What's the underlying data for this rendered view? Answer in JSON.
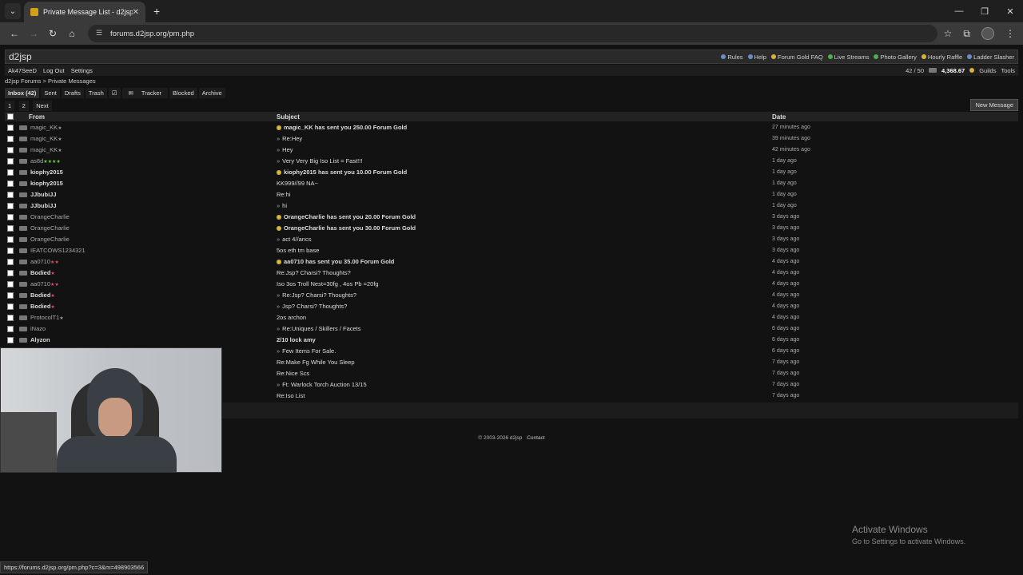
{
  "browser": {
    "tab_title": "Private Message List - d2jsp",
    "url": "forums.d2jsp.org/pm.php",
    "status_url": "https://forums.d2jsp.org/pm.php?c=3&m=498903566"
  },
  "site": {
    "logo": "d2jsp",
    "top_links": [
      "Rules",
      "Help",
      "Forum Gold FAQ",
      "Live Streams",
      "Photo Gallery",
      "Hourly Raffle",
      "Ladder Slasher"
    ],
    "user": "Ak47SeeD",
    "logout": "Log Out",
    "settings": "Settings",
    "pm_count": "42 / 50",
    "gold": "4,368.67",
    "guilds": "Guilds",
    "tools": "Tools",
    "crumb1": "d2jsp Forums",
    "crumb_sep": ">",
    "crumb2": "Private Messages"
  },
  "folders": {
    "inbox": "Inbox (42)",
    "sent": "Sent",
    "drafts": "Drafts",
    "trash": "Trash",
    "tracker": "Tracker",
    "blocked": "Blocked",
    "archive": "Archive"
  },
  "pager": {
    "p1": "1",
    "p2": "2",
    "next": "Next",
    "new_message": "New Message"
  },
  "table": {
    "col_from": "From",
    "col_subject": "Subject",
    "col_date": "Date"
  },
  "messages": [
    {
      "from": "magic_KK",
      "subject": "magic_KK has sent you 250.00 Forum Gold",
      "date": "27 minutes ago"
    },
    {
      "from": "magic_KK",
      "subject": "Re:Hey",
      "date": "39 minutes ago"
    },
    {
      "from": "magic_KK",
      "subject": "Hey",
      "date": "42 minutes ago"
    },
    {
      "from": "as8d",
      "subject": "Very Very Big Iso List = Fast!!!",
      "date": "1 day ago"
    },
    {
      "from": "kiophy2015",
      "subject": "kiophy2015 has sent you 10.00 Forum Gold",
      "date": "1 day ago"
    },
    {
      "from": "kiophy2015",
      "subject": "KK999//99 NA~",
      "date": "1 day ago"
    },
    {
      "from": "JJbubiJJ",
      "subject": "Re:hi",
      "date": "1 day ago"
    },
    {
      "from": "JJbubiJJ",
      "subject": "hi",
      "date": "1 day ago"
    },
    {
      "from": "OrangeCharlie",
      "subject": "OrangeCharlie has sent you 20.00 Forum Gold",
      "date": "3 days ago"
    },
    {
      "from": "OrangeCharlie",
      "subject": "OrangeCharlie has sent you 30.00 Forum Gold",
      "date": "3 days ago"
    },
    {
      "from": "OrangeCharlie",
      "subject": "act 4//ancs",
      "date": "3 days ago"
    },
    {
      "from": "IEATCOWS1234321",
      "subject": "5os eth tm base",
      "date": "3 days ago"
    },
    {
      "from": "aa0710",
      "subject": "aa0710 has sent you 35.00 Forum Gold",
      "date": "4 days ago"
    },
    {
      "from": "Bodied",
      "subject": "Re:Jsp? Charsi? Thoughts?",
      "date": "4 days ago"
    },
    {
      "from": "aa0710",
      "subject": "Iso 3os Troll Nest=30fg , 4os Pb =20fg",
      "date": "4 days ago"
    },
    {
      "from": "Bodied",
      "subject": "Re:Jsp? Charsi? Thoughts?",
      "date": "4 days ago"
    },
    {
      "from": "Bodied",
      "subject": "Jsp? Charsi? Thoughts?",
      "date": "4 days ago"
    },
    {
      "from": "ProtocolT1",
      "subject": "2os archon",
      "date": "4 days ago"
    },
    {
      "from": "iNazo",
      "subject": "Re:Uniques / Skillers / Facets",
      "date": "6 days ago"
    },
    {
      "from": "Alyzon",
      "subject": "2/10 lock amy",
      "date": "6 days ago"
    },
    {
      "from": "",
      "subject": "Few Items For Sale.",
      "date": "6 days ago"
    },
    {
      "from": "",
      "subject": "Re:Make Fg While You Sleep",
      "date": "7 days ago"
    },
    {
      "from": "",
      "subject": "Re:Nice Scs",
      "date": "7 days ago"
    },
    {
      "from": "",
      "subject": "Ft: Warlock Torch Auction 13/15",
      "date": "7 days ago"
    },
    {
      "from": "",
      "subject": "Re:Iso List",
      "date": "7 days ago"
    }
  ],
  "footer": {
    "copyright": "© 2003-2026 d2jsp",
    "contact": "Contact"
  },
  "windows": {
    "line1": "Activate Windows",
    "line2": "Go to Settings to activate Windows."
  }
}
